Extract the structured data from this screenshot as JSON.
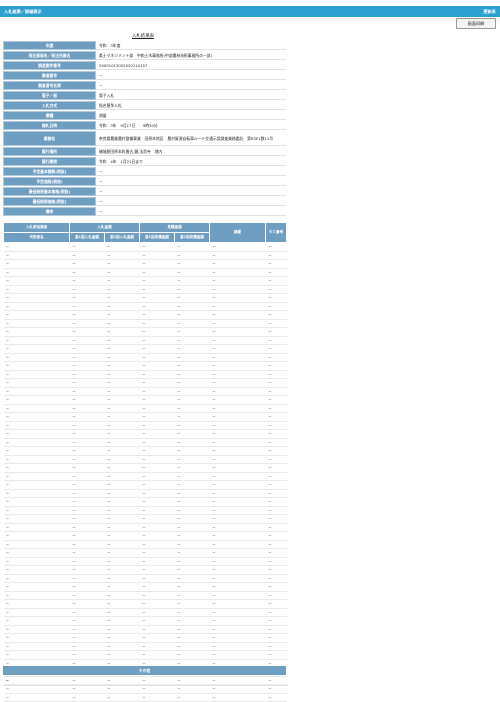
{
  "header": {
    "title": "入札結果／詳細表示",
    "system": "更新系"
  },
  "toolbar": {
    "print_label": "画面印刷"
  },
  "page_title": "入札結果表",
  "info_rows": [
    {
      "label": "年度",
      "value": "令和　3年度"
    },
    {
      "label": "発注部局名／発注所属名",
      "value": "県土マネジメント部　中和土木事務所(中部農林技術事務所の一部)"
    },
    {
      "label": "調達案件番号",
      "value": "29001013052020210157"
    },
    {
      "label": "業者番号",
      "value": "－"
    },
    {
      "label": "業者番号名称",
      "value": "－"
    },
    {
      "label": "電子／紙",
      "value": "電子入札"
    },
    {
      "label": "入札方式",
      "value": "指名競争入札"
    },
    {
      "label": "業種",
      "value": "測量"
    },
    {
      "label": "開札日時",
      "value": "令和　3年　9月17日　　9時30分"
    },
    {
      "label": "業務名",
      "value": "奈良県農業農村整備事業　田原本地区　農村資源自転車ルート交通示設調査業務委託　第R3E1数11号"
    },
    {
      "label": "履行場所",
      "value": "磯城郡田原本町唐古,鍵,法貴寺　地内"
    },
    {
      "label": "履行期限",
      "value": "令和　4年　1月21日まで"
    },
    {
      "label": "予定基本額税(税抜)",
      "value": "－"
    },
    {
      "label": "予定価格(税抜)",
      "value": "－"
    },
    {
      "label": "最低制限基本価格(税抜)",
      "value": "－"
    },
    {
      "label": "最低制限価格(税抜)",
      "value": "－"
    },
    {
      "label": "備考",
      "value": "－"
    }
  ],
  "bids": {
    "headers_top": [
      "入札参加業者",
      "入札金額",
      "見積金額",
      "摘要",
      "ＫＣ番号"
    ],
    "headers_sub": [
      "代表者名",
      "第1回入札金額",
      "第2回入札金額",
      "第1回見積金額",
      "第2回見積金額"
    ],
    "empty_cell": "－"
  },
  "other": {
    "header": "その他",
    "value": "－"
  }
}
